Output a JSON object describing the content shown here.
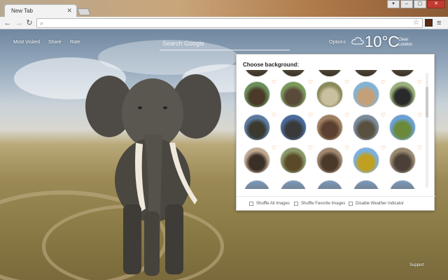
{
  "browser": {
    "tab_title": "New Tab",
    "tab_close": "✕",
    "window_controls": [
      "▾",
      "–",
      "▢",
      "✕"
    ],
    "nav": {
      "back": "←",
      "forward": "→",
      "reload": "↻"
    },
    "address_icon": "⌕",
    "star": "☆",
    "menu": "≡"
  },
  "topbar": {
    "links": [
      "Most Visited",
      "Share",
      "Rate"
    ],
    "search_placeholder": "Search Google",
    "options": "Options"
  },
  "weather": {
    "temperature": "10°C",
    "condition": "Clear",
    "location": "London",
    "icon": "cloud-icon"
  },
  "panel": {
    "title": "Choose background:",
    "options": [
      "Shuffle All Images",
      "Shuffle Favorite Images",
      "Disable Weather Indicator"
    ],
    "heart_glyph": "♡",
    "thumbnails": [
      {
        "colors": [
          "#6a8f5a",
          "#4b3a2a"
        ]
      },
      {
        "colors": [
          "#7a9a5a",
          "#5a4a3a"
        ]
      },
      {
        "colors": [
          "#8a8a5a",
          "#c9c0a0"
        ]
      },
      {
        "colors": [
          "#7fb4d8",
          "#c4a07a"
        ]
      },
      {
        "colors": [
          "#9ab07a",
          "#2a2a2a"
        ]
      },
      {
        "colors": [
          "#5a7aa0",
          "#3a3a30"
        ]
      },
      {
        "colors": [
          "#4a6a9a",
          "#3a3a3a"
        ]
      },
      {
        "colors": [
          "#a08060",
          "#5a4030"
        ]
      },
      {
        "colors": [
          "#7a8a9a",
          "#5a5040"
        ]
      },
      {
        "colors": [
          "#6aa0d8",
          "#6a8a3a"
        ]
      },
      {
        "colors": [
          "#c0a890",
          "#3a3028"
        ]
      },
      {
        "colors": [
          "#8a9a6a",
          "#5a4a2a"
        ]
      },
      {
        "colors": [
          "#a08870",
          "#4a3828"
        ]
      },
      {
        "colors": [
          "#7ab0e0",
          "#c0a020"
        ]
      },
      {
        "colors": [
          "#9a8a70",
          "#4a4038"
        ]
      }
    ]
  },
  "footer": {
    "support": "Support"
  }
}
